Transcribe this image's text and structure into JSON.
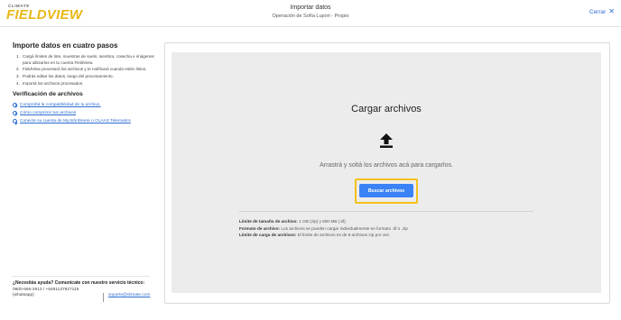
{
  "header": {
    "logo_top": "CLIMATE",
    "logo_main": "FIELDVIEW",
    "title": "Importar datos",
    "subtitle": "Operación de Sofía Lupori - Propio",
    "close_label": "Cerrar"
  },
  "left": {
    "steps_title": "Importe datos en cuatro pasos",
    "steps": [
      {
        "num": "1.",
        "text": "Cargá límites de lote, muestras de suelo, siembra, cosecha e imágenes para utilizarlos en tu cuenta FieldView."
      },
      {
        "num": "2.",
        "text": "FieldView procesará los archivos y te notificará cuando estén listos."
      },
      {
        "num": "3.",
        "text": "Podrás editar los datos, luego del procesamiento."
      },
      {
        "num": "4.",
        "text": "Importá los archivos procesados."
      }
    ],
    "verification_title": "Verificación de archivos",
    "links": [
      "Comprobá la compatibilidad de tu archivo.",
      "Cómo comprimir tus archivos",
      "Conecte su cuenta de MyJohnDeere o CLAAS Telematics"
    ],
    "help": {
      "title": "¿Necesitás ayuda? Comunicate con nuestro servicio técnico:",
      "phones": "0800-666-2913 / +5491137927115 (whatsapp)",
      "email": "soporte@climate.com"
    }
  },
  "main": {
    "title": "Cargar archivos",
    "upload_icon": "upload-icon",
    "drop_text": "Arrastrá y soltá los archivos acá para cargarlos.",
    "browse_label": "Buscar archivos",
    "limits": [
      {
        "label": "Límite de tamaño de archivo:",
        "text": "1 GB (zip) y 500 MB (.tif)."
      },
      {
        "label": "Formato de archivo:",
        "text": "Los archivos se pueden cargar individualmente en formato .tif o .zip"
      },
      {
        "label": "Límite de carga de archivos:",
        "text": "El límite de archivos es de 8 archivos zip por vez."
      }
    ]
  },
  "colors": {
    "accent": "#3b82f6",
    "highlight": "#f4c21b",
    "link": "#2a6ccf",
    "brand": "#e8b817"
  }
}
